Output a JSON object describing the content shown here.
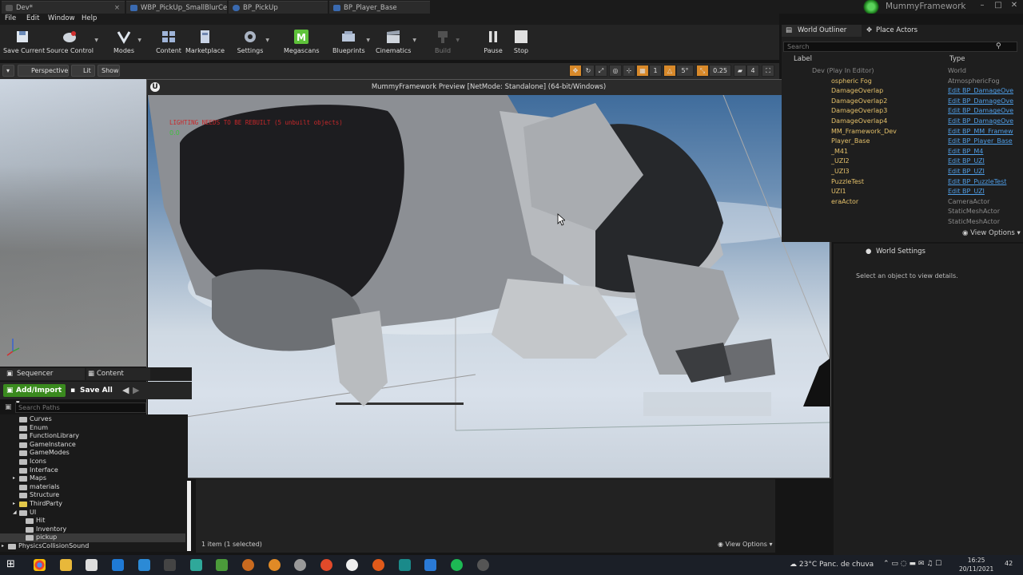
{
  "tabs": [
    {
      "label": "Dev*"
    },
    {
      "label": "WBP_PickUp_SmallBlurCe"
    },
    {
      "label": "BP_PickUp"
    },
    {
      "label": "BP_Player_Base"
    }
  ],
  "app_title": "MummyFramework",
  "menu": [
    "File",
    "Edit",
    "Window",
    "Help"
  ],
  "toolbar": {
    "save_current": "Save Current",
    "source_control": "Source Control",
    "modes": "Modes",
    "content": "Content",
    "marketplace": "Marketplace",
    "settings": "Settings",
    "megascans": "Megascans",
    "blueprints": "Blueprints",
    "cinematics": "Cinematics",
    "build": "Build",
    "pause": "Pause",
    "stop": "Stop"
  },
  "viewport": {
    "perspective": "Perspective",
    "lit": "Lit",
    "show": "Show",
    "snap_angle": "1",
    "rot_snap": "5°",
    "scale_snap": "0.25",
    "cam_speed": "4"
  },
  "preview": {
    "title": "MummyFramework Preview [NetMode: Standalone]  (64-bit/Windows)",
    "warning": "LIGHTING NEEDS TO BE REBUILT (5 unbuilt objects)",
    "fps": "0.0"
  },
  "outliner": {
    "tab": "World Outliner",
    "tab2": "Place Actors",
    "search": "Search",
    "col_label": "Label",
    "col_type": "Type",
    "rows": [
      {
        "label": "Dev (Play In Editor)",
        "type": "World",
        "link": false
      },
      {
        "label": "ospheric Fog",
        "type": "AtmosphericFog",
        "link": false
      },
      {
        "label": "DamageOverlap",
        "type": "Edit BP_DamageOve",
        "link": true
      },
      {
        "label": "DamageOverlap2",
        "type": "Edit BP_DamageOve",
        "link": true
      },
      {
        "label": "DamageOverlap3",
        "type": "Edit BP_DamageOve",
        "link": true
      },
      {
        "label": "DamageOverlap4",
        "type": "Edit BP_DamageOve",
        "link": true
      },
      {
        "label": "MM_Framework_Dev",
        "type": "Edit BP_MM_Framew",
        "link": true
      },
      {
        "label": "Player_Base",
        "type": "Edit BP_Player_Base",
        "link": true
      },
      {
        "label": "_M41",
        "type": "Edit BP_M4",
        "link": true
      },
      {
        "label": "_UZI2",
        "type": "Edit BP_UZI",
        "link": true
      },
      {
        "label": "_UZI3",
        "type": "Edit BP_UZI",
        "link": true
      },
      {
        "label": "PuzzleTest",
        "type": "Edit BP_PuzzleTest",
        "link": true
      },
      {
        "label": "UZI1",
        "type": "Edit BP_UZI",
        "link": true
      },
      {
        "label": "eraActor",
        "type": "CameraActor",
        "link": false
      },
      {
        "label": "",
        "type": "StaticMeshActor",
        "link": false
      },
      {
        "label": "",
        "type": "StaticMeshActor",
        "link": false
      }
    ],
    "view_options": "View Options"
  },
  "details": {
    "tab": "World Settings",
    "empty": "Select an object to view details."
  },
  "content_browser": {
    "tab_sequencer": "Sequencer",
    "tab_cb": "Content Browser",
    "add_import": "Add/Import",
    "save_all": "Save All",
    "search": "Search Paths",
    "folders": [
      {
        "name": "Curves",
        "indent": 0,
        "yellow": false,
        "arrow": ""
      },
      {
        "name": "Enum",
        "indent": 0,
        "yellow": false,
        "arrow": ""
      },
      {
        "name": "FunctionLibrary",
        "indent": 0,
        "yellow": false,
        "arrow": ""
      },
      {
        "name": "GameInstance",
        "indent": 0,
        "yellow": false,
        "arrow": ""
      },
      {
        "name": "GameModes",
        "indent": 0,
        "yellow": false,
        "arrow": ""
      },
      {
        "name": "Icons",
        "indent": 0,
        "yellow": false,
        "arrow": ""
      },
      {
        "name": "Interface",
        "indent": 0,
        "yellow": false,
        "arrow": ""
      },
      {
        "name": "Maps",
        "indent": 0,
        "yellow": false,
        "arrow": "▸"
      },
      {
        "name": "materials",
        "indent": 0,
        "yellow": false,
        "arrow": ""
      },
      {
        "name": "Structure",
        "indent": 0,
        "yellow": false,
        "arrow": ""
      },
      {
        "name": "ThirdParty",
        "indent": 0,
        "yellow": true,
        "arrow": "▸"
      },
      {
        "name": "UI",
        "indent": 0,
        "yellow": false,
        "arrow": "◢"
      },
      {
        "name": "Hit",
        "indent": 1,
        "yellow": false,
        "arrow": ""
      },
      {
        "name": "Inventory",
        "indent": 1,
        "yellow": false,
        "arrow": ""
      },
      {
        "name": "pickup",
        "indent": 1,
        "yellow": false,
        "arrow": "",
        "selected": true
      },
      {
        "name": "PhysicsCollisionSound",
        "indent": -1,
        "yellow": false,
        "arrow": "▸"
      }
    ],
    "selection": "1 item (1 selected)",
    "view_options": "View Options"
  },
  "taskbar": {
    "weather": "23°C  Panc. de chuva",
    "time": "16:25",
    "date": "20/11/2021",
    "badge": "42"
  }
}
